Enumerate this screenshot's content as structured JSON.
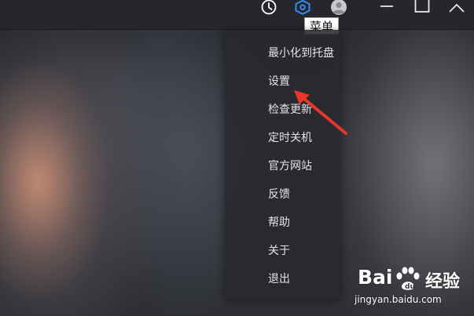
{
  "topbar": {
    "icons": [
      "history-icon",
      "settings-icon",
      "avatar-icon",
      "minimize-icon",
      "maximize-icon",
      "collapse-icon"
    ],
    "tooltip": "菜单",
    "accent_color": "#2f8ff0"
  },
  "menu": {
    "items": [
      {
        "label": "最小化到托盘"
      },
      {
        "label": "设置"
      },
      {
        "label": "检查更新"
      },
      {
        "label": "定时关机"
      },
      {
        "label": "官方网站"
      },
      {
        "label": "反馈"
      },
      {
        "label": "帮助"
      },
      {
        "label": "关于"
      },
      {
        "label": "退出"
      }
    ]
  },
  "annotation": {
    "color": "#e8352e",
    "points_to": "设置"
  },
  "watermark": {
    "brand": "Bai",
    "brand_suffix": "经验",
    "url": "jingyan.baidu.com"
  }
}
